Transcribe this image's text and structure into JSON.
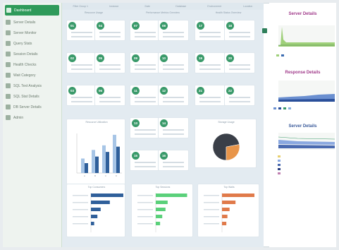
{
  "sidebar": {
    "items": [
      {
        "label": "Dashboard",
        "icon": "dashboard-icon"
      },
      {
        "label": "Server Details",
        "icon": "server-icon"
      },
      {
        "label": "Server Monitor",
        "icon": "monitor-icon"
      },
      {
        "label": "Query Stats",
        "icon": "chart-icon"
      },
      {
        "label": "Session Details",
        "icon": "sessions-icon"
      },
      {
        "label": "Health Checks",
        "icon": "check-icon"
      },
      {
        "label": "Wait Category",
        "icon": "list-icon"
      },
      {
        "label": "SQL Text Analysis",
        "icon": "sql-icon"
      },
      {
        "label": "SQL Stat Details",
        "icon": "stat-icon"
      },
      {
        "label": "DB Server Details",
        "icon": "db-icon"
      },
      {
        "label": "Admin",
        "icon": "admin-icon"
      }
    ]
  },
  "topbar": [
    "Filter Group 1",
    "Instance",
    "Date",
    "Database",
    "Environment",
    "Location"
  ],
  "sections": {
    "left": "Resource Usage",
    "middle": "Performance Metrics Overview",
    "right": "Health Status Overview",
    "bar_chart": "Resource Utilization",
    "pie_chart": "Storage Usage",
    "h1": "Top Consumers",
    "h2": "Top Sessions",
    "h3": "Top Waits"
  },
  "tiles": [
    "01",
    "04",
    "07",
    "08",
    "17",
    "18",
    "02",
    "05",
    "09",
    "10",
    "19",
    "20",
    "03",
    "06",
    "11",
    "12",
    "21",
    "22",
    "13",
    "14",
    "15",
    "16"
  ],
  "right_panel": {
    "server_details": "Server Details",
    "response_details": "Response Details",
    "server_details_2": "Server Details"
  },
  "colors": {
    "green": "#2f9a5a",
    "badge": "#3a9a6a",
    "blue": "#2f5f9a",
    "lightblue": "#a7c5e6",
    "orange": "#e07a4a",
    "pie_dark": "#3a3f48",
    "pie_orange": "#e8954a"
  },
  "chart_data": [
    {
      "type": "bar",
      "categories": [
        "A",
        "B",
        "C",
        "D"
      ],
      "series": [
        {
          "values": [
            22,
            35,
            42,
            58
          ]
        },
        {
          "values": [
            15,
            25,
            32,
            40
          ]
        }
      ],
      "ylim": [
        0,
        60
      ]
    },
    {
      "type": "pie",
      "values": [
        72,
        28
      ]
    },
    {
      "type": "bar",
      "orientation": "horizontal",
      "categories": [
        "1",
        "2",
        "3",
        "4",
        "5"
      ],
      "values": [
        60,
        35,
        18,
        12,
        6
      ]
    },
    {
      "type": "bar",
      "orientation": "horizontal",
      "categories": [
        "1",
        "2",
        "3",
        "4",
        "5"
      ],
      "values": [
        58,
        22,
        18,
        12,
        8
      ]
    },
    {
      "type": "bar",
      "orientation": "horizontal",
      "categories": [
        "1",
        "2",
        "3",
        "4",
        "5"
      ],
      "values": [
        60,
        25,
        14,
        10,
        8
      ]
    }
  ]
}
